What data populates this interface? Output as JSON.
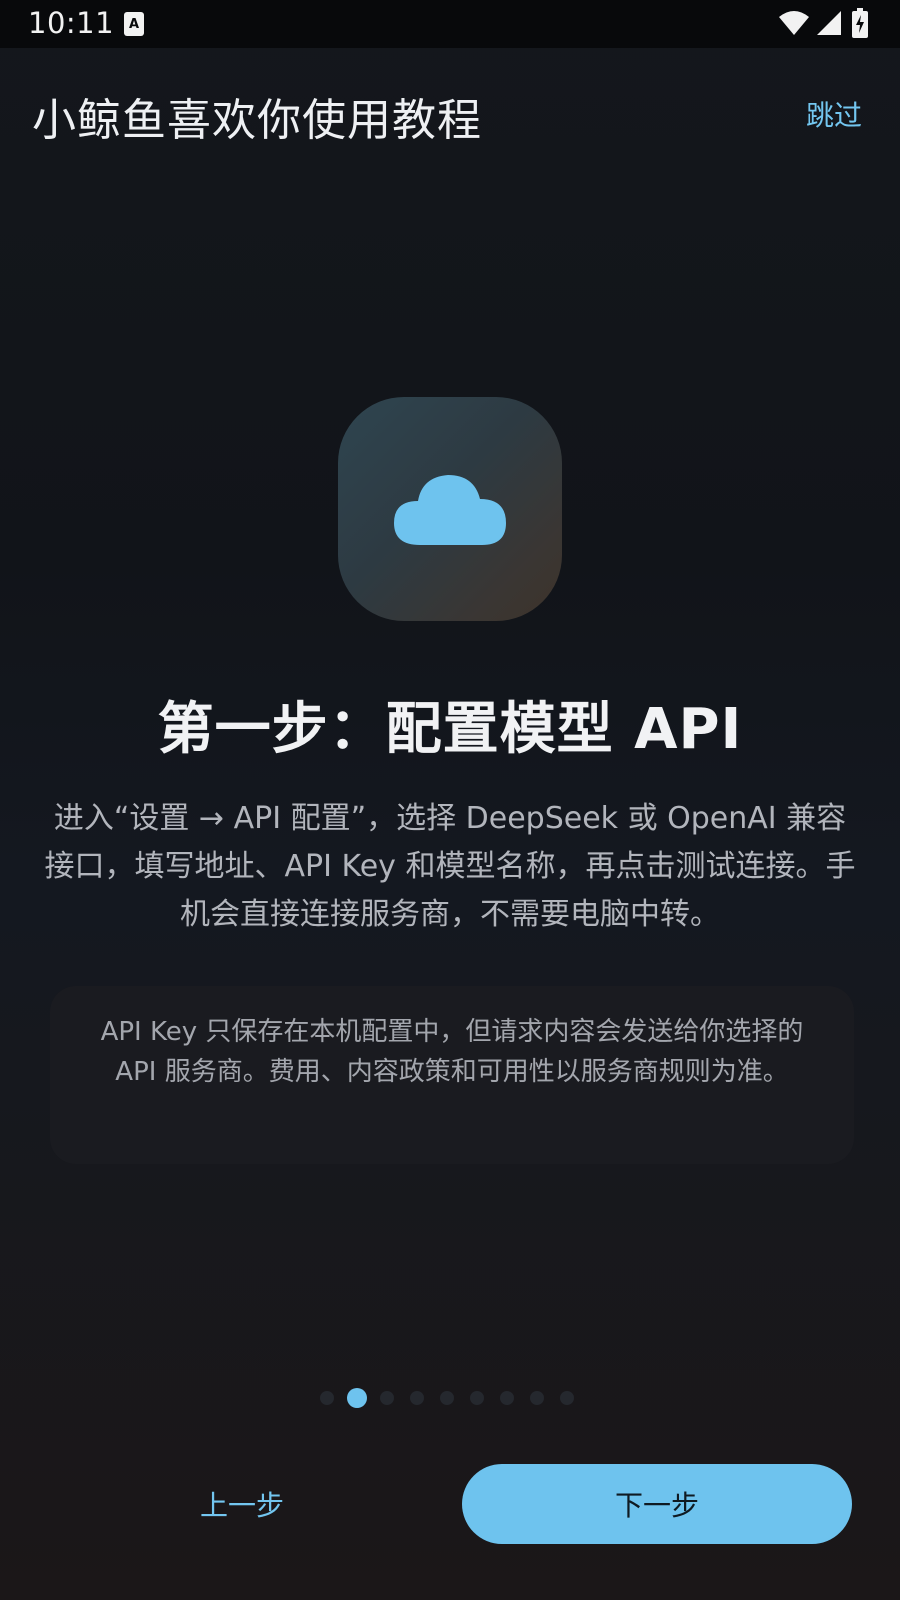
{
  "status_bar": {
    "time": "10:11",
    "notification_icon": "accessibility-app-icon",
    "notification_glyph": "A",
    "icons": [
      "wifi-icon",
      "cellular-signal-icon",
      "battery-charging-icon"
    ]
  },
  "header": {
    "title": "小鲸鱼喜欢你使用教程",
    "skip_label": "跳过"
  },
  "step": {
    "icon": "cloud-icon",
    "title": "第一步：配置模型 API",
    "description": "进入“设置 → API 配置”，选择 DeepSeek 或 OpenAI 兼容接口，填写地址、API Key 和模型名称，再点击测试连接。手机会直接连接服务商，不需要电脑中转。",
    "note": "API Key 只保存在本机配置中，但请求内容会发送给你选择的 API 服务商。费用、内容政策和可用性以服务商规则为准。"
  },
  "pager": {
    "total": 9,
    "current": 2
  },
  "footer": {
    "prev_label": "上一步",
    "next_label": "下一步"
  },
  "colors": {
    "accent": "#6ec3ee",
    "background": "#111318",
    "card": "#1a1b20"
  }
}
